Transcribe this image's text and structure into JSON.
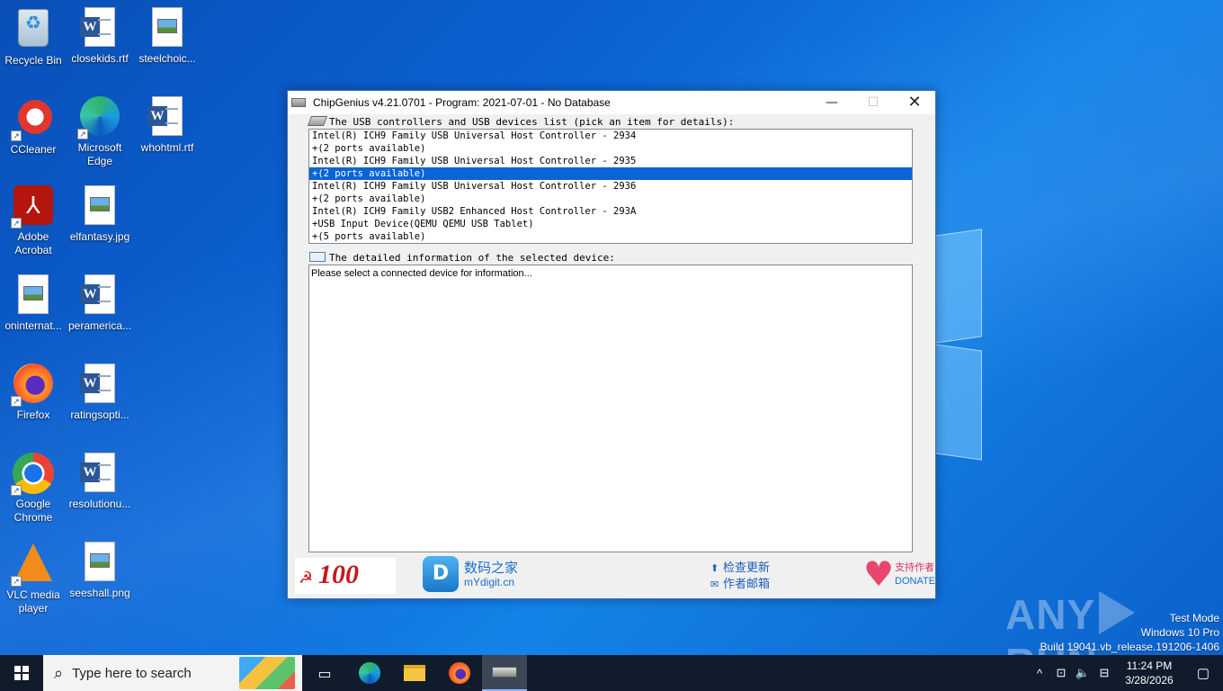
{
  "desktop": {
    "icons": [
      {
        "label": "Recycle Bin"
      },
      {
        "label": "closekids.rtf"
      },
      {
        "label": "steelchoic..."
      },
      {
        "label": "CCleaner"
      },
      {
        "label": "Microsoft Edge"
      },
      {
        "label": "whohtml.rtf"
      },
      {
        "label": "Adobe Acrobat"
      },
      {
        "label": "elfantasy.jpg"
      },
      {
        "label": "oninternat..."
      },
      {
        "label": "peramerica..."
      },
      {
        "label": "Firefox"
      },
      {
        "label": "ratingsopti..."
      },
      {
        "label": "Google Chrome"
      },
      {
        "label": "resolutionu..."
      },
      {
        "label": "VLC media player"
      },
      {
        "label": "seeshall.png"
      }
    ]
  },
  "window": {
    "title": "ChipGenius v4.21.0701 - Program: 2021-07-01 - No Database",
    "min_glyph": "—",
    "max_glyph": "☐",
    "close_glyph": "✕",
    "list_label": "The USB controllers and USB devices list (pick an item for details):",
    "devices": [
      {
        "text": "Intel(R) ICH9 Family USB Universal Host Controller - 2934"
      },
      {
        "text": "+(2 ports available)"
      },
      {
        "text": "Intel(R) ICH9 Family USB Universal Host Controller - 2935"
      },
      {
        "text": "+(2 ports available)",
        "selected": true
      },
      {
        "text": "Intel(R) ICH9 Family USB Universal Host Controller - 2936"
      },
      {
        "text": "+(2 ports available)"
      },
      {
        "text": "Intel(R) ICH9 Family USB2 Enhanced Host Controller - 293A"
      },
      {
        "text": "+USB Input Device(QEMU QEMU USB Tablet)"
      },
      {
        "text": "+(5 ports available)"
      }
    ],
    "detail_label": "The detailed information of the selected device:",
    "detail_text": "Please select a connected device for information...",
    "footer": {
      "banner_number": "100",
      "mydigit_cn": "数码之家",
      "mydigit_en": "mYdigit.cn",
      "check_update": "检查更新",
      "author_email": "作者邮箱",
      "donate_cn": "支持作者",
      "donate_en": "DONATE"
    }
  },
  "watermark": {
    "brand_left": "ANY",
    "brand_right": "RUN",
    "line1": "Test Mode",
    "line2": "Windows 10 Pro",
    "line3": "Build 19041.vb_release.191206-1406"
  },
  "taskbar": {
    "search_placeholder": "Type here to search",
    "tray_up": "^",
    "clock_time": "11:24 PM",
    "clock_date": "3/28/2026"
  },
  "colors": {
    "selection": "#0a64d8",
    "taskbar": "#101c2c",
    "desktop": "#0b63d4"
  }
}
